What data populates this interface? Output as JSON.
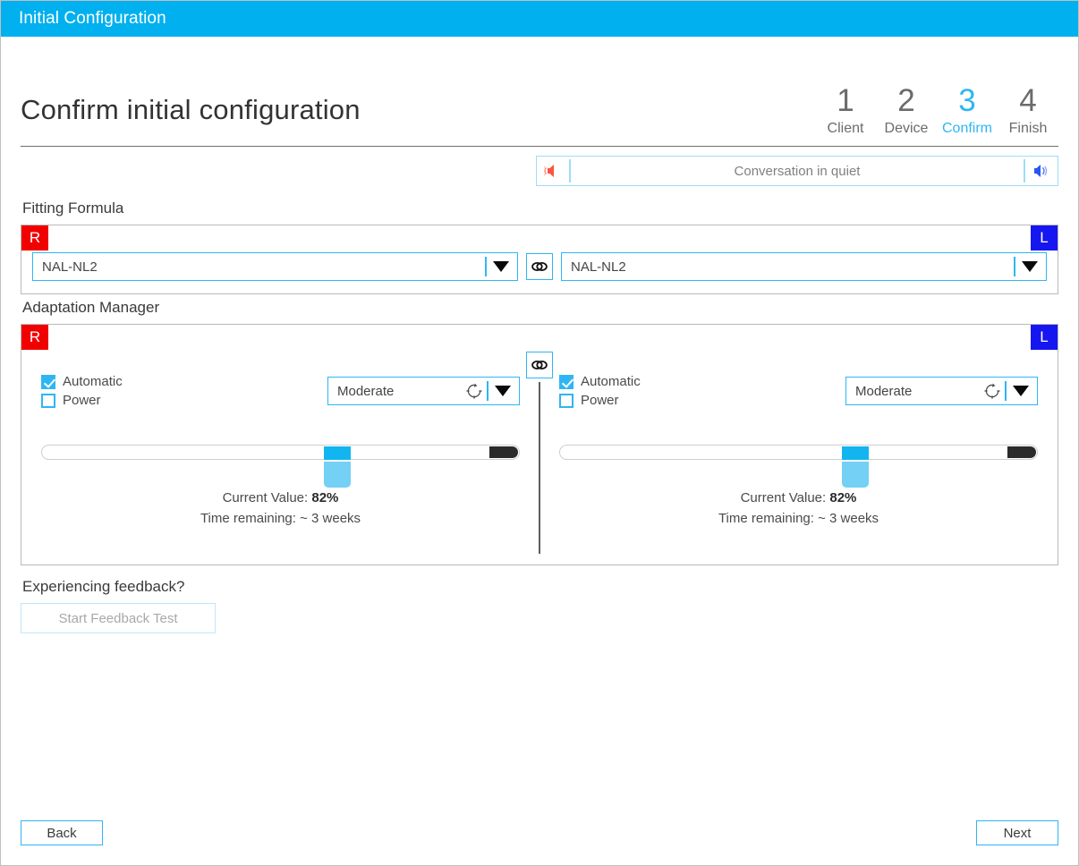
{
  "window": {
    "title": "Initial Configuration"
  },
  "header": {
    "page_title": "Confirm initial configuration",
    "steps": [
      {
        "num": "1",
        "label": "Client",
        "active": false
      },
      {
        "num": "2",
        "label": "Device",
        "active": false
      },
      {
        "num": "3",
        "label": "Confirm",
        "active": true
      },
      {
        "num": "4",
        "label": "Finish",
        "active": false
      }
    ]
  },
  "conversation_bar": {
    "label": "Conversation in quiet",
    "left_icon": "speaker-muted-red-icon",
    "right_icon": "speaker-blue-icon"
  },
  "fitting_formula": {
    "section_label": "Fitting Formula",
    "right_badge": "R",
    "left_badge": "L",
    "right_value": "NAL-NL2",
    "left_value": "NAL-NL2",
    "link_icon": "chain-link-icon"
  },
  "adaptation_manager": {
    "section_label": "Adaptation Manager",
    "right_badge": "R",
    "left_badge": "L",
    "link_icon": "chain-link-icon",
    "right": {
      "automatic_label": "Automatic",
      "automatic_checked": true,
      "power_label": "Power",
      "power_checked": false,
      "level_value": "Moderate",
      "level_icon": "adaptation-cycle-icon",
      "current_value_label": "Current Value: ",
      "current_value": "82%",
      "time_remaining": "Time remaining: ~ 3 weeks",
      "slider_percent": 62
    },
    "left": {
      "automatic_label": "Automatic",
      "automatic_checked": true,
      "power_label": "Power",
      "power_checked": false,
      "level_value": "Moderate",
      "level_icon": "adaptation-cycle-icon",
      "current_value_label": "Current Value: ",
      "current_value": "82%",
      "time_remaining": "Time remaining: ~ 3 weeks",
      "slider_percent": 62
    }
  },
  "feedback": {
    "question": "Experiencing feedback?",
    "button_label": "Start Feedback Test",
    "button_disabled": true
  },
  "footer": {
    "back_label": "Back",
    "next_label": "Next"
  },
  "colors": {
    "titlebar": "#00b0ef",
    "accent": "#2eb6f4",
    "right_badge": "#f20000",
    "left_badge": "#1616f0",
    "slider_thumb": "#12b5ef",
    "slider_end": "#2b2b2b"
  }
}
